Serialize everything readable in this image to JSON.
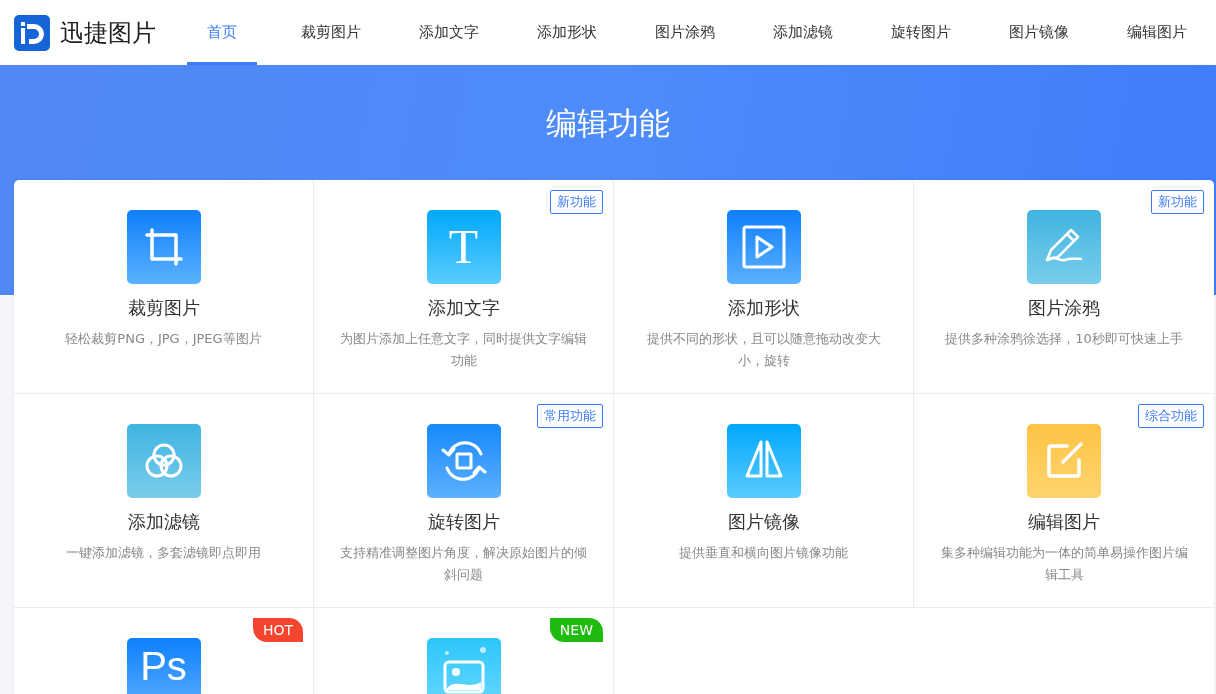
{
  "brand": {
    "name": "迅捷图片"
  },
  "nav": [
    {
      "label": "首页",
      "selected": true
    },
    {
      "label": "裁剪图片",
      "selected": false
    },
    {
      "label": "添加文字",
      "selected": false
    },
    {
      "label": "添加形状",
      "selected": false
    },
    {
      "label": "图片涂鸦",
      "selected": false
    },
    {
      "label": "添加滤镜",
      "selected": false
    },
    {
      "label": "旋转图片",
      "selected": false
    },
    {
      "label": "图片镜像",
      "selected": false
    },
    {
      "label": "编辑图片",
      "selected": false
    }
  ],
  "hero": {
    "title": "编辑功能"
  },
  "features": [
    {
      "kind": "crop",
      "title": "裁剪图片",
      "description": "轻松裁剪PNG，JPG，JPEG等图片"
    },
    {
      "kind": "text",
      "glyph": "T",
      "title": "添加文字",
      "description": "为图片添加上任意文字，同时提供文字编辑功能",
      "badge": {
        "kind": "outline",
        "text": "新功能"
      }
    },
    {
      "kind": "shape",
      "title": "添加形状",
      "description": "提供不同的形状，且可以随意拖动改变大小，旋转"
    },
    {
      "kind": "pen",
      "title": "图片涂鸦",
      "description": "提供多种涂鸦徐选择，10秒即可快速上手",
      "badge": {
        "kind": "outline",
        "text": "新功能"
      }
    },
    {
      "kind": "filter",
      "title": "添加滤镜",
      "description": "一键添加滤镜，多套滤镜即点即用"
    },
    {
      "kind": "rotate",
      "title": "旋转图片",
      "description": "支持精准调整图片角度，解决原始图片的倾斜问题",
      "badge": {
        "kind": "outline",
        "text": "常用功能"
      }
    },
    {
      "kind": "mirror",
      "title": "图片镜像",
      "description": "提供垂直和横向图片镜像功能"
    },
    {
      "kind": "edit",
      "title": "编辑图片",
      "description": "集多种编辑功能为一体的简单易操作图片编辑工具",
      "badge": {
        "kind": "outline",
        "text": "综合功能"
      }
    },
    {
      "kind": "ps",
      "glyph": "Ps",
      "badge": {
        "kind": "ribbon",
        "text": "HOT",
        "color": "#f5452f"
      }
    },
    {
      "kind": "image",
      "badge": {
        "kind": "ribbon",
        "text": "NEW",
        "color": "#1fbb0f"
      }
    }
  ]
}
